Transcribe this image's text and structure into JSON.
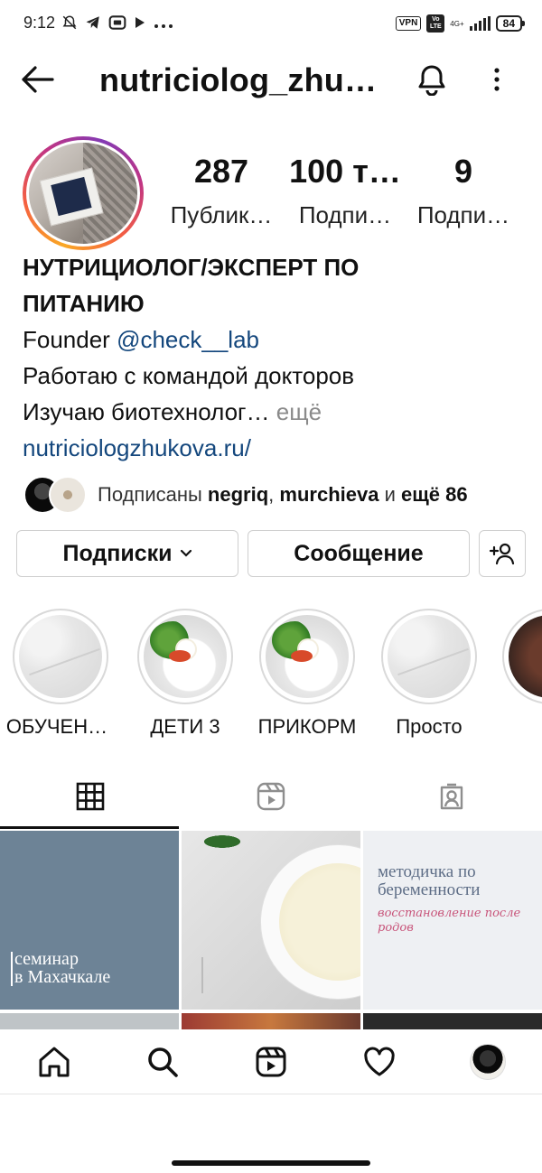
{
  "status_bar": {
    "time": "9:12",
    "vpn": "VPN",
    "volte": "Vo LTE",
    "network": "4G+",
    "battery": "84"
  },
  "header": {
    "username": "nutriciolog_zhu…"
  },
  "profile": {
    "stats": [
      {
        "value": "287",
        "label": "Публик…"
      },
      {
        "value": "100 т…",
        "label": "Подпи…"
      },
      {
        "value": "9",
        "label": "Подпи…"
      }
    ],
    "bio": {
      "name_line1": "НУТРИЦИОЛОГ/ЭКСПЕРТ ПО",
      "name_line2": "ПИТАНИЮ",
      "founder_prefix": "Founder ",
      "founder_mention": "@check__lab",
      "line3": "Работаю с командой докторов",
      "line4": "Изучаю биотехнолог…",
      "more": " ещё",
      "website": "nutriciologzhukova.ru/"
    },
    "followed_by": {
      "prefix": "Подписаны ",
      "user1": "negriq",
      "sep": ", ",
      "user2": "murchieva",
      "mid": " и ",
      "more": "ещё 86"
    }
  },
  "actions": {
    "following_label": "Подписки",
    "message_label": "Сообщение"
  },
  "highlights": [
    {
      "label": "ОБУЧЕН…"
    },
    {
      "label": "ДЕТИ 3"
    },
    {
      "label": "ПРИКОРМ"
    },
    {
      "label": "Просто"
    }
  ],
  "posts": [
    {
      "text_line1": "семинар",
      "text_line2": "в Махачкале"
    },
    {},
    {
      "title_line1": "методичка по",
      "title_line2": "беременности",
      "script": "восстановление после родов"
    }
  ]
}
